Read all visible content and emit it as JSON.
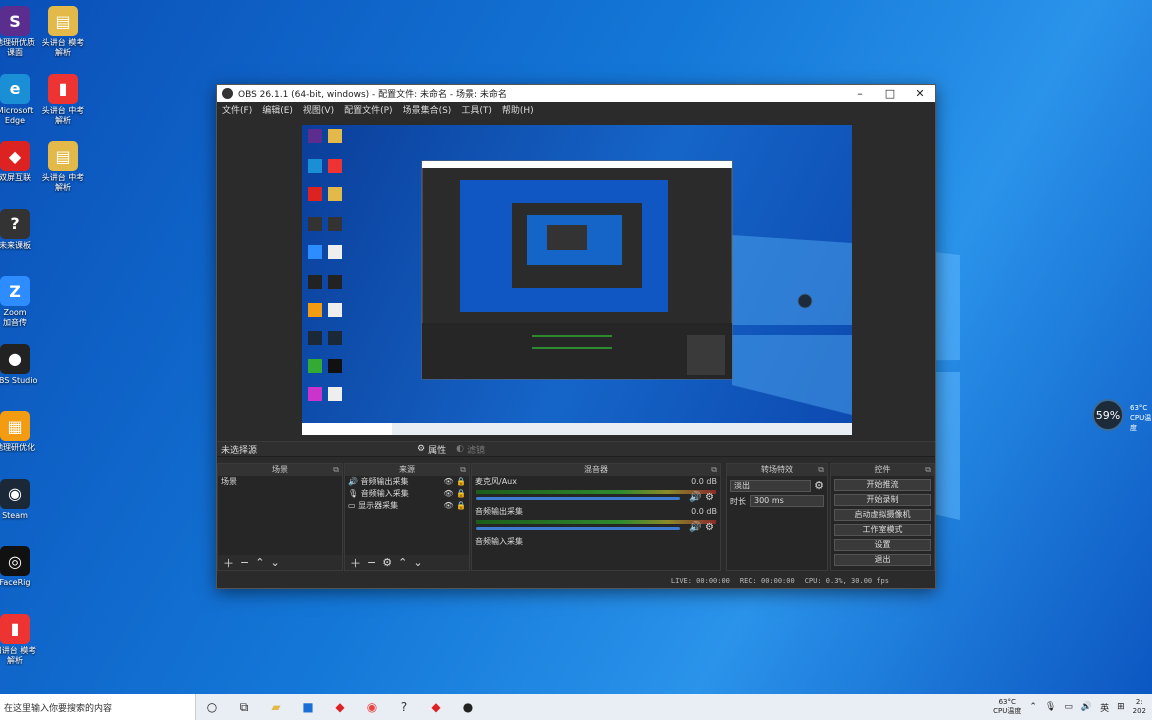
{
  "desktop_icons": [
    {
      "label": "地理研优质\n课面",
      "color": "#5b2d8e",
      "glyph": "S"
    },
    {
      "label": "Microsoft\nEdge",
      "color": "#1a8fd6",
      "glyph": "e"
    },
    {
      "label": "双屏互联",
      "color": "#d22",
      "glyph": "◆"
    },
    {
      "label": "未来课板",
      "color": "#333",
      "glyph": "?"
    },
    {
      "label": "Zoom\n加音传",
      "color": "#2d8cff",
      "glyph": "Z"
    },
    {
      "label": "OBS Studio",
      "color": "#222",
      "glyph": "●"
    },
    {
      "label": "地理研优化",
      "color": "#f39c12",
      "glyph": "▦"
    },
    {
      "label": "Steam",
      "color": "#1b2838",
      "glyph": "◉"
    },
    {
      "label": "FaceRig",
      "color": "#111",
      "glyph": "◎"
    },
    {
      "label": "四讲台 模考\n解析",
      "color": "#e33",
      "glyph": "▮"
    }
  ],
  "desktop_icons2": [
    {
      "label": "头讲台 模考\n解析",
      "color": "#e3b94a",
      "glyph": "▤"
    },
    {
      "label": "头讲台 中考\n解析",
      "color": "#e33",
      "glyph": "▮"
    },
    {
      "label": "头讲台 中考\n解析",
      "color": "#e3b94a",
      "glyph": "▤"
    }
  ],
  "window": {
    "title": "OBS 26.1.1 (64-bit, windows) - 配置文件: 未命名 - 场景: 未命名",
    "menu": [
      "文件(F)",
      "编辑(E)",
      "视图(V)",
      "配置文件(P)",
      "场景集合(S)",
      "工具(T)",
      "帮助(H)"
    ],
    "no_source": "未选择源",
    "props": "属性",
    "filters": "滤镜",
    "panels": {
      "scenes": {
        "title": "场景",
        "items": [
          "场景"
        ]
      },
      "sources": {
        "title": "来源",
        "items": [
          "音频输出采集",
          "音频输入采集",
          "显示器采集"
        ]
      },
      "mixer": {
        "title": "混音器",
        "channels": [
          {
            "name": "麦克风/Aux",
            "db": "0.0 dB"
          },
          {
            "name": "音频输出采集",
            "db": "0.0 dB"
          },
          {
            "name": "音频输入采集",
            "db": ""
          }
        ]
      },
      "transitions": {
        "title": "转场特效",
        "type": "淡出",
        "duration_label": "时长",
        "duration": "300 ms"
      },
      "controls": {
        "title": "控件",
        "buttons": [
          "开始推流",
          "开始录制",
          "启动虚拟摄像机",
          "工作室模式",
          "设置",
          "退出"
        ]
      }
    },
    "status": {
      "live": "LIVE: 00:00:00",
      "rec": "REC: 00:00:00",
      "cpu": "CPU: 0.3%, 30.00 fps"
    }
  },
  "cpu_widget": {
    "percent": "59%",
    "temp": "63°C",
    "label": "CPU温度"
  },
  "taskbar": {
    "search_placeholder": "在这里输入你要搜索的内容",
    "icons": [
      "task-view-icon",
      "cortana-icon",
      "file-explorer-icon",
      "store-icon",
      "app-icon",
      "chrome-icon",
      "help-icon",
      "app2-icon",
      "obs-icon"
    ],
    "tray": {
      "temp": "63°C",
      "temp_label": "CPU温度",
      "lang": "英",
      "time": "2:",
      "date": "202"
    }
  },
  "colors": {
    "accent": "#3d7bd0",
    "panel_bg": "#262626"
  }
}
